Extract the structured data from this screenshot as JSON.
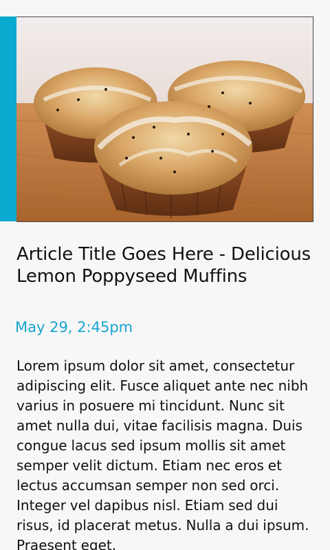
{
  "article": {
    "hero_image": "lemon-poppyseed-muffins-photo",
    "title": "Article Title Goes Here - Delicious Lemon Poppyseed Muffins",
    "date": "May 29, 2:45pm",
    "body": "Lorem ipsum dolor sit amet, consectetur  adipiscing elit. Fusce aliquet ante nec nibh varius in posuere mi tincidunt. Nunc sit amet nulla dui, vitae facilisis magna. Duis congue lacus sed ipsum mollis sit amet semper velit dictum. Etiam nec eros et lectus accumsan semper non sed orci. Integer vel dapibus nisl. Etiam sed dui risus, id placerat metus. Nulla a dui ipsum. Praesent eget."
  },
  "colors": {
    "accent": "#0aa9d0",
    "date_text": "#1aa3cf",
    "background": "#f7f7f7",
    "text": "#111111"
  }
}
